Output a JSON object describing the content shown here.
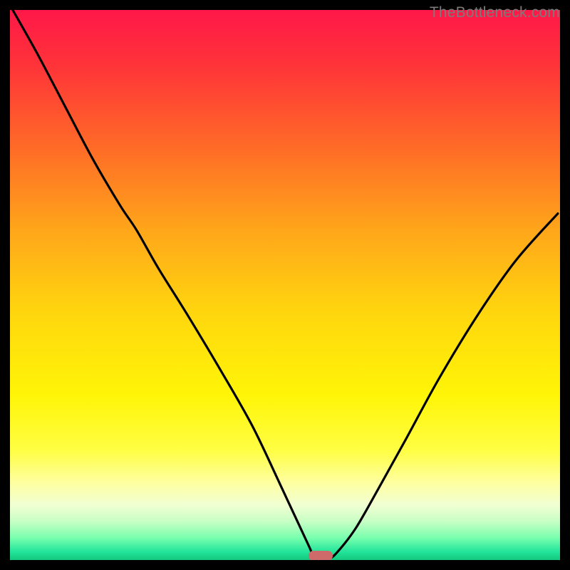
{
  "watermark": "TheBottleneck.com",
  "chart_data": {
    "type": "line",
    "title": "",
    "xlabel": "",
    "ylabel": "",
    "xlim": [
      0,
      100
    ],
    "ylim": [
      0,
      100
    ],
    "grid": false,
    "legend": false,
    "marker": {
      "x": 56.5,
      "y": 0,
      "color": "#cf6a6a"
    },
    "gradient_stops": [
      {
        "pct": 0,
        "color": "#ff1848"
      },
      {
        "pct": 10,
        "color": "#ff3339"
      },
      {
        "pct": 25,
        "color": "#ff6b27"
      },
      {
        "pct": 40,
        "color": "#ffa61a"
      },
      {
        "pct": 55,
        "color": "#ffd60e"
      },
      {
        "pct": 70,
        "color": "#fff507"
      },
      {
        "pct": 80,
        "color": "#fffe43"
      },
      {
        "pct": 86,
        "color": "#feffa1"
      },
      {
        "pct": 90,
        "color": "#f1ffd3"
      },
      {
        "pct": 93,
        "color": "#c7ffc4"
      },
      {
        "pct": 96,
        "color": "#77ffae"
      },
      {
        "pct": 98.5,
        "color": "#22e49a"
      },
      {
        "pct": 100,
        "color": "#14c87e"
      }
    ],
    "series": [
      {
        "name": "bottleneck-curve",
        "color": "#000000",
        "x": [
          0.5,
          5,
          10,
          15,
          20,
          23,
          27,
          32,
          38,
          44,
          49,
          52.5,
          54.5,
          55.5,
          58,
          60,
          63,
          67,
          72,
          78,
          85,
          92,
          99.6
        ],
        "y": [
          100,
          92,
          82.5,
          73,
          64.5,
          60,
          53,
          45,
          35,
          24.5,
          14,
          6.5,
          2.2,
          0.2,
          0.2,
          2,
          6,
          13,
          22,
          33,
          44.5,
          54.5,
          63
        ]
      }
    ]
  }
}
